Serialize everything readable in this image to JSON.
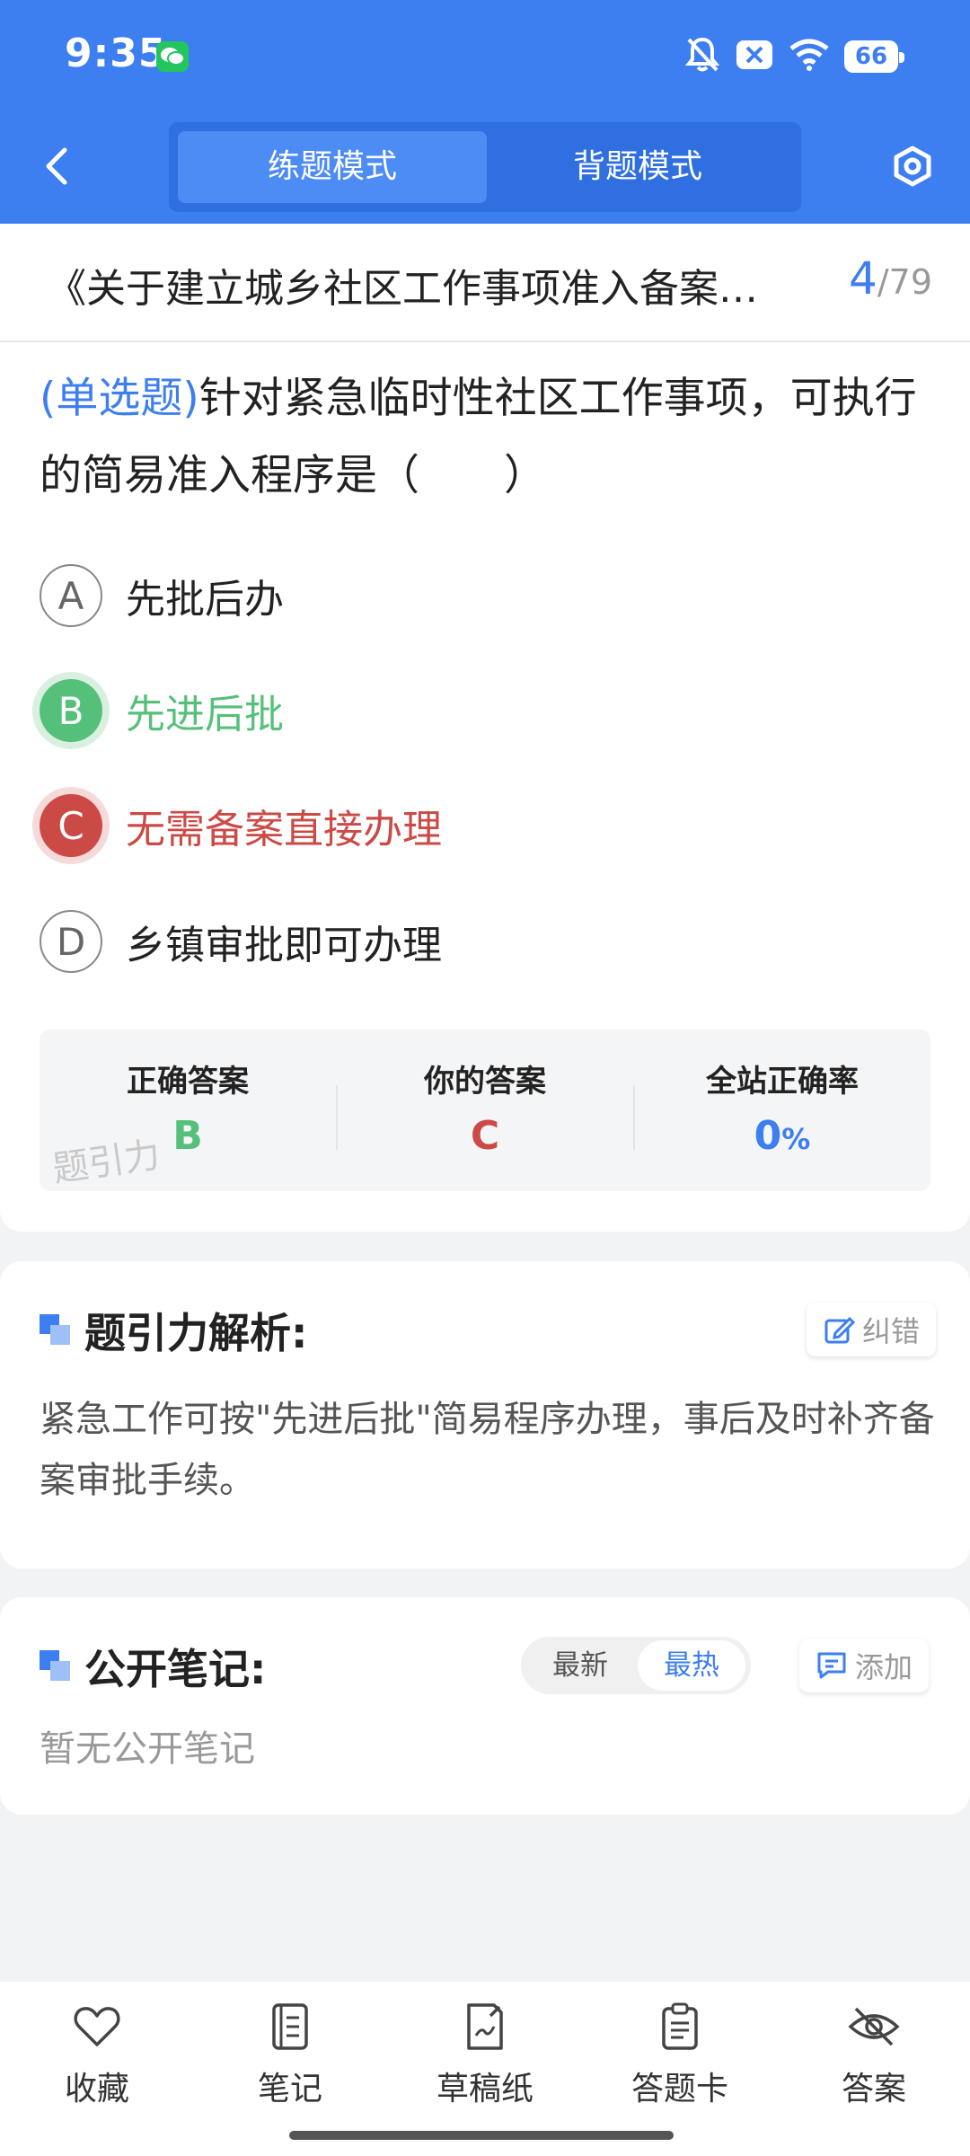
{
  "status_bar": {
    "time": "9:35",
    "battery": "66"
  },
  "mode": {
    "practice": "练题模式",
    "memorize": "背题模式"
  },
  "header": {
    "title": "《关于建立城乡社区工作事项准入备案…",
    "current": "4",
    "total": "/79"
  },
  "question": {
    "type": "(单选题)",
    "text": "针对紧急临时性社区工作事项，可执行的简易准入程序是（　　）",
    "options": [
      {
        "letter": "A",
        "text": "先批后办",
        "state": "normal"
      },
      {
        "letter": "B",
        "text": "先进后批",
        "state": "correct"
      },
      {
        "letter": "C",
        "text": "无需备案直接办理",
        "state": "wrong"
      },
      {
        "letter": "D",
        "text": "乡镇审批即可办理",
        "state": "normal"
      }
    ]
  },
  "result": {
    "correct_label": "正确答案",
    "correct_value": "B",
    "yours_label": "你的答案",
    "yours_value": "C",
    "rate_label": "全站正确率",
    "rate_value": "0",
    "rate_unit": "%",
    "watermark": "题引力"
  },
  "analysis": {
    "title": "题引力解析:",
    "report_label": "纠错",
    "text": "紧急工作可按\"先进后批\"简易程序办理，事后及时补齐备案审批手续。"
  },
  "notes": {
    "title": "公开笔记:",
    "sort_latest": "最新",
    "sort_hot": "最热",
    "add_label": "添加",
    "empty": "暂无公开笔记"
  },
  "bottom_nav": {
    "favorite": "收藏",
    "notes": "笔记",
    "scratch": "草稿纸",
    "answer_card": "答题卡",
    "answer": "答案"
  },
  "colors": {
    "accent": "#3d7ef0",
    "correct": "#55c07a",
    "wrong": "#cb4a45"
  }
}
